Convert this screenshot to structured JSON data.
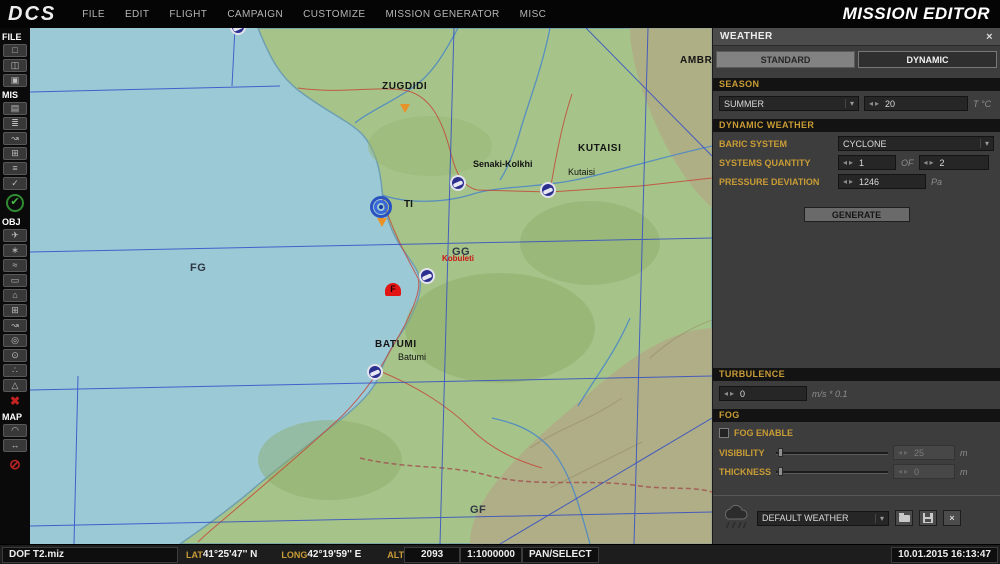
{
  "ui": {
    "spin_left": "◂",
    "spin_right": "▸",
    "dropdown_arrow": "▾",
    "close": "×"
  },
  "menubar": {
    "logo": "DCS",
    "items": [
      "FILE",
      "EDIT",
      "FLIGHT",
      "CAMPAIGN",
      "CUSTOMIZE",
      "MISSION GENERATOR",
      "MISC"
    ],
    "title": "MISSION EDITOR"
  },
  "toolbar": {
    "file_label": "FILE",
    "file_icons": [
      {
        "name": "new-mission-icon",
        "glyph": "□"
      },
      {
        "name": "open-mission-icon",
        "glyph": "◫"
      },
      {
        "name": "save-mission-icon",
        "glyph": "▣"
      }
    ],
    "mis_label": "MIS",
    "mis_icons": [
      {
        "name": "mission-options-icon",
        "glyph": "▤"
      },
      {
        "name": "briefing-icon",
        "glyph": "≣"
      },
      {
        "name": "mission-route-icon",
        "glyph": "↝"
      },
      {
        "name": "triggers-icon",
        "glyph": "⊞"
      },
      {
        "name": "mission-goals-icon",
        "glyph": "≡"
      },
      {
        "name": "mission-check-icon",
        "glyph": "✓"
      }
    ],
    "validate_glyph": "✔",
    "obj_label": "OBJ",
    "obj_icons": [
      {
        "name": "add-airplane-icon",
        "glyph": "✈"
      },
      {
        "name": "add-helicopter-icon",
        "glyph": "∗"
      },
      {
        "name": "add-ship-icon",
        "glyph": "≈"
      },
      {
        "name": "add-vehicle-icon",
        "glyph": "▭"
      },
      {
        "name": "add-static-object-icon",
        "glyph": "⌂"
      },
      {
        "name": "add-template-icon",
        "glyph": "⊞"
      },
      {
        "name": "route-tool-icon",
        "glyph": "↝"
      },
      {
        "name": "trigger-zone-icon",
        "glyph": "◎"
      },
      {
        "name": "bullseye-icon",
        "glyph": "⊙"
      },
      {
        "name": "rings-icon",
        "glyph": "∴"
      },
      {
        "name": "shape-template-icon",
        "glyph": "△"
      }
    ],
    "delete_glyph": "✖",
    "map_label": "MAP",
    "map_icons": [
      {
        "name": "measure-tool-icon",
        "glyph": "◠"
      },
      {
        "name": "distance-tool-icon",
        "glyph": "↔"
      }
    ],
    "stop_glyph": "⊘"
  },
  "map": {
    "labels": {
      "zugdidi": "ZUGDIDI",
      "ambrolauri": "AMBROL",
      "kutaisi_region": "KUTAISI",
      "kutaisi_city": "Kutaisi",
      "senaki": "Senaki-Kolkhi",
      "poti_fragment": "TI",
      "batumi_region": "BATUMI",
      "batumi_city": "Batumi",
      "kobuleti": "Kobuleti",
      "grid_fg": "FG",
      "grid_gg": "GG",
      "grid_gf": "GF"
    },
    "marker_f": "F"
  },
  "weather": {
    "title": "WEATHER",
    "tabs": {
      "standard": "STANDARD",
      "dynamic": "DYNAMIC"
    },
    "season": {
      "header": "SEASON",
      "value": "SUMMER",
      "temperature": "20",
      "unit": "T °C"
    },
    "dynamic": {
      "header": "DYNAMIC WEATHER",
      "baric_label": "BARIC SYSTEM",
      "baric_value": "CYCLONE",
      "quantity_label": "SYSTEMS QUANTITY",
      "quantity_value": "1",
      "of": "OF",
      "quantity_total": "2",
      "pressure_label": "PRESSURE DEVIATION",
      "pressure_value": "1246",
      "pressure_unit": "Pa",
      "generate": "GENERATE"
    },
    "turbulence": {
      "header": "TURBULENCE",
      "value": "0",
      "unit": "m/s * 0.1"
    },
    "fog": {
      "header": "FOG",
      "enable_label": "FOG ENABLE",
      "visibility_label": "VISIBILITY",
      "visibility_value": "25",
      "visibility_unit": "m",
      "thickness_label": "THICKNESS",
      "thickness_value": "0",
      "thickness_unit": "m"
    },
    "preset": {
      "value": "DEFAULT WEATHER"
    }
  },
  "statusbar": {
    "filename": "DOF T2.miz",
    "lat_label": "LAT",
    "lat_value": "41°25'47'' N",
    "long_label": "LONG",
    "long_value": "42°19'59'' E",
    "alt_label": "ALT",
    "alt_value": "2093",
    "scale": "1:1000000",
    "mode": "PAN/SELECT",
    "datetime": "10.01.2015 16:13:47"
  }
}
